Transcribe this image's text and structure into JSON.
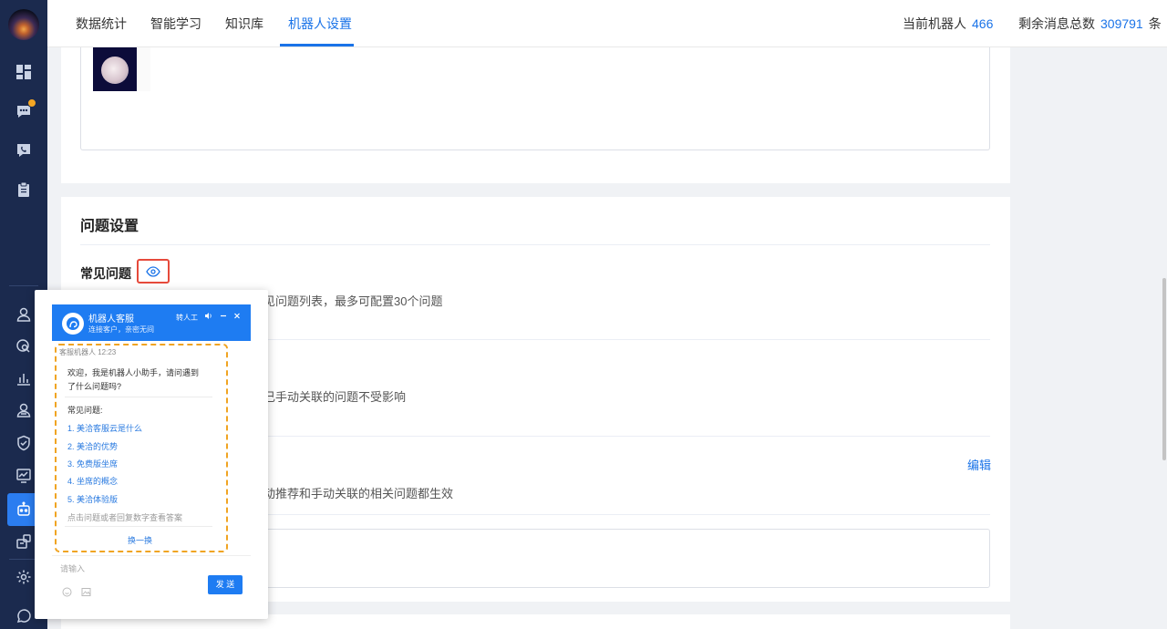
{
  "nav": {
    "tabs": [
      {
        "label": "数据统计"
      },
      {
        "label": "智能学习"
      },
      {
        "label": "知识库"
      },
      {
        "label": "机器人设置"
      }
    ],
    "robot_label": "当前机器人",
    "robot_count": "466",
    "msg_label": "剩余消息总数",
    "msg_count": "309791",
    "msg_unit": "条"
  },
  "section": {
    "title": "问题设置",
    "faq_title": "常见问题",
    "desc1": "见问题列表，最多可配置30个问题",
    "desc2": "己手动关联的问题不受影响",
    "desc3": "动推荐和手动关联的相关问题都生效",
    "edit": "编辑"
  },
  "chat": {
    "name": "机器人客服",
    "subtitle": "连接客户，亲密无间",
    "transfer": "转人工",
    "sender": "客服机器人",
    "time": "12:23",
    "welcome1": "欢迎，我是机器人小助手，请问遇到",
    "welcome2": "了什么问题吗?",
    "faq_header": "常见问题:",
    "faq": [
      "1. 美洽客服云是什么",
      "2. 美洽的优势",
      "3. 免费版坐席",
      "4. 坐席的概念",
      "5. 美洽体验版"
    ],
    "hint": "点击问题或者回复数字查看答案",
    "refresh": "换一换",
    "placeholder": "请输入",
    "send": "发 送"
  },
  "colors": {
    "accent": "#1a73e8",
    "sidebar": "#1b2a4e",
    "highlight_red": "#e64a3b",
    "dash_orange": "#f0a422"
  }
}
